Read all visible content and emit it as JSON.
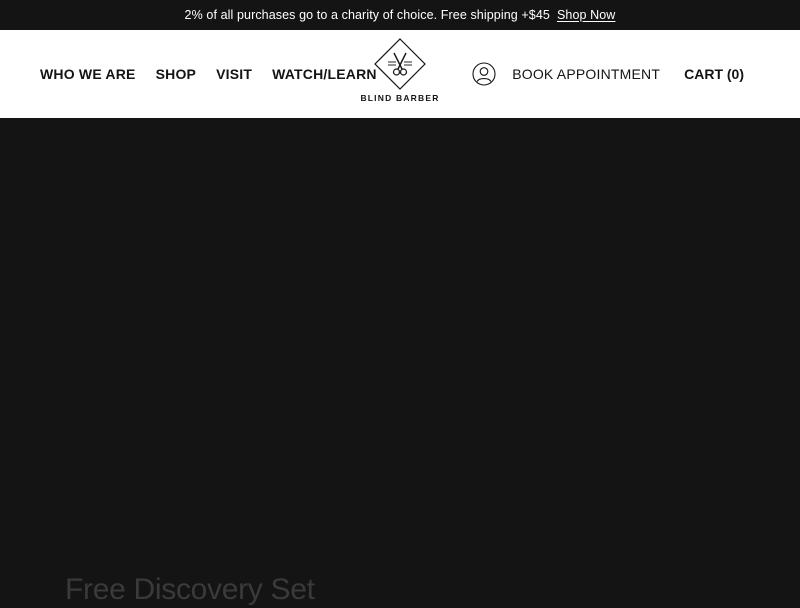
{
  "announcement": {
    "message": "2% of all purchases go to a charity of choice. Free shipping +$45",
    "link_label": "Shop Now"
  },
  "nav": {
    "left_items": [
      {
        "label": "WHO WE ARE"
      },
      {
        "label": "SHOP"
      },
      {
        "label": "VISIT"
      },
      {
        "label": "WATCH/LEARN"
      }
    ],
    "logo_text": "BLIND BARBER",
    "account_icon": "user-account-icon",
    "book_label": "BOOK APPOINTMENT",
    "cart_label": "CART (0)"
  },
  "hero": {
    "title": "Free Discovery Set"
  },
  "colors": {
    "dark": "#141414",
    "light": "#ffffff",
    "hero_title": "#3a3a3a"
  }
}
